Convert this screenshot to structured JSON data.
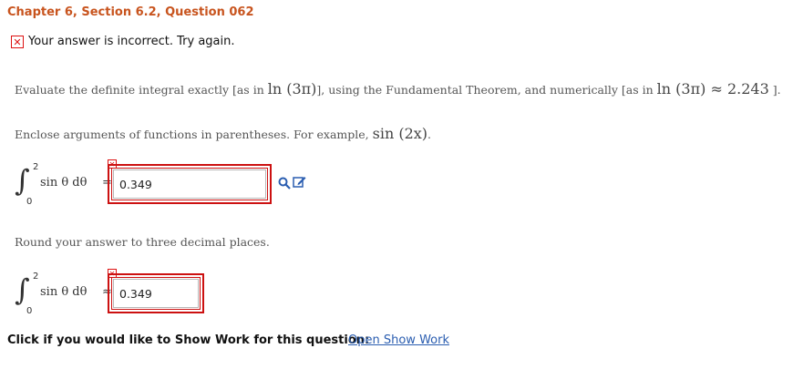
{
  "header": {
    "title": "Chapter 6, Section 6.2, Question 062"
  },
  "status": {
    "icon": "x-mark-icon",
    "message": "Your answer is incorrect.  Try again.",
    "color": "#cc1111"
  },
  "question": {
    "line1_pre": "Evaluate the definite integral exactly [as in ",
    "line1_math1": "ln (3π)",
    "line1_mid": "], using the Fundamental Theorem, and numerically [as in ",
    "line1_math2": "ln (3π) ≈ 2.243",
    "line1_post": " ].",
    "line2_pre": "Enclose arguments of functions in parentheses. For example, ",
    "line2_math": "sin (2x)",
    "line2_post": ".",
    "round_note": "Round your answer to three decimal places."
  },
  "integral1": {
    "upper": "2",
    "lower": "0",
    "integrand": "sin θ dθ",
    "relation": "=",
    "answer": "0.349"
  },
  "integral2": {
    "upper": "2",
    "lower": "0",
    "integrand": "sin θ dθ",
    "relation": "≈",
    "answer": "0.349"
  },
  "tools": {
    "preview_icon": "magnifier-icon",
    "edit_icon": "pencil-edit-icon"
  },
  "show_work": {
    "prompt": "Click if you would like to Show Work for this question:",
    "link": "Open Show Work"
  },
  "colors": {
    "accent": "#c8541e",
    "error": "#cc1111",
    "link": "#2a5db0"
  }
}
